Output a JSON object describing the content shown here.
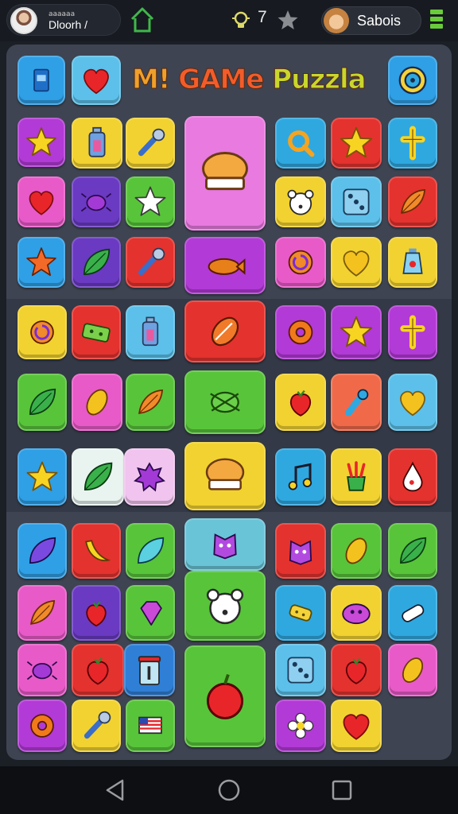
{
  "header": {
    "profile_small": "aaaaaa",
    "profile_name": "Dloorh /",
    "level_value": "7",
    "player_name": "Sabois",
    "accent_green": "#6acb3a"
  },
  "title": {
    "text": "M! GAMe Puzzla",
    "colors": [
      "#f0a02a",
      "#f35c2a",
      "#c9d62c"
    ]
  },
  "icons": {
    "home": "home-icon",
    "level": "bulb-icon",
    "star": "star-icon",
    "menu": "menu-icon"
  },
  "tiles": [
    {
      "name": "phone-tile",
      "icon": "phone",
      "bg": "#2f9fe6"
    },
    {
      "name": "heart-tile",
      "icon": "heart",
      "bg": "#5cc0ea"
    },
    {
      "name": "target-tile",
      "icon": "target",
      "bg": "#2f9fe6"
    },
    {
      "name": "star-tile",
      "icon": "star",
      "bg": "#b23ad6"
    },
    {
      "name": "bottle-tile",
      "icon": "bottle",
      "bg": "#f2d230"
    },
    {
      "name": "tool-tile",
      "icon": "tool",
      "bg": "#f2d230"
    },
    {
      "name": "chef-hat-tile",
      "icon": "hat",
      "bg": "#e87ae0"
    },
    {
      "name": "search-tile",
      "icon": "search",
      "bg": "#2fa8e0"
    },
    {
      "name": "star-tile",
      "icon": "star",
      "bg": "#e4322e"
    },
    {
      "name": "cross-tile",
      "icon": "cross",
      "bg": "#2fa8e0"
    },
    {
      "name": "heart-tile",
      "icon": "heart",
      "bg": "#e85ac8"
    },
    {
      "name": "bug-tile",
      "icon": "bug",
      "bg": "#6a3ac2"
    },
    {
      "name": "star-tile",
      "icon": "star-white",
      "bg": "#58c43a"
    },
    {
      "name": "bear-tile",
      "icon": "bear",
      "bg": "#f2d230"
    },
    {
      "name": "dice-tile",
      "icon": "dice",
      "bg": "#5cc0ea"
    },
    {
      "name": "feather-tile",
      "icon": "feather",
      "bg": "#e4322e"
    },
    {
      "name": "star-tile",
      "icon": "star-orange",
      "bg": "#2f9fe6"
    },
    {
      "name": "leaf-tile",
      "icon": "leaf",
      "bg": "#6a3ac2"
    },
    {
      "name": "wrench-tile",
      "icon": "tool",
      "bg": "#e4322e"
    },
    {
      "name": "fish-tile",
      "icon": "fish",
      "bg": "#b23ad6"
    },
    {
      "name": "spiral-tile",
      "icon": "spiral",
      "bg": "#e85ac8"
    },
    {
      "name": "heart-tile",
      "icon": "heart-gold",
      "bg": "#f2d230"
    },
    {
      "name": "potion-tile",
      "icon": "potion",
      "bg": "#f2d230"
    },
    {
      "name": "swirl-tile",
      "icon": "spiral",
      "bg": "#f2d230"
    },
    {
      "name": "knot-tile",
      "icon": "knot",
      "bg": "#e4322e"
    },
    {
      "name": "bottle-tile",
      "icon": "bottle",
      "bg": "#5cc0ea"
    },
    {
      "name": "candy-tile",
      "icon": "candy",
      "bg": "#e4322e"
    },
    {
      "name": "donut-tile",
      "icon": "donut",
      "bg": "#b23ad6"
    },
    {
      "name": "star-tile",
      "icon": "star",
      "bg": "#b23ad6"
    },
    {
      "name": "cross-tile",
      "icon": "cross",
      "bg": "#b23ad6"
    },
    {
      "name": "leaf-tile",
      "icon": "leaf",
      "bg": "#58c43a"
    },
    {
      "name": "leaf-tile",
      "icon": "seed",
      "bg": "#e85ac8"
    },
    {
      "name": "carrot-tile",
      "icon": "feather",
      "bg": "#58c43a"
    },
    {
      "name": "candy-tile",
      "icon": "candy-green",
      "bg": "#58c43a"
    },
    {
      "name": "berry-tile",
      "icon": "berry",
      "bg": "#f2d230"
    },
    {
      "name": "rocket-tile",
      "icon": "rocket",
      "bg": "#f06a4a"
    },
    {
      "name": "heart-tile",
      "icon": "heart-gold",
      "bg": "#5cc0ea"
    },
    {
      "name": "star-tile",
      "icon": "star",
      "bg": "#2f9fe6"
    },
    {
      "name": "leaf-tile",
      "icon": "leaf",
      "bg": "#e9f4f0"
    },
    {
      "name": "splat-tile",
      "icon": "splat",
      "bg": "#f0c4ee"
    },
    {
      "name": "bun-tile",
      "icon": "hat",
      "bg": "#f2d230"
    },
    {
      "name": "music-tile",
      "icon": "music",
      "bg": "#2fa8e0"
    },
    {
      "name": "plant-tile",
      "icon": "plant",
      "bg": "#f2d230"
    },
    {
      "name": "drop-tile",
      "icon": "drop",
      "bg": "#e4322e"
    },
    {
      "name": "leaf-tile",
      "icon": "leaf-purple",
      "bg": "#2f9fe6"
    },
    {
      "name": "banana-tile",
      "icon": "banana",
      "bg": "#e4322e"
    },
    {
      "name": "leaf-tile",
      "icon": "leaf-blue",
      "bg": "#58c43a"
    },
    {
      "name": "monster-tile",
      "icon": "monster",
      "bg": "#6ac4d8"
    },
    {
      "name": "monster-tile",
      "icon": "monster",
      "bg": "#e4322e"
    },
    {
      "name": "leaf-tile",
      "icon": "seed",
      "bg": "#58c43a"
    },
    {
      "name": "leaf-tile",
      "icon": "leaf",
      "bg": "#58c43a"
    },
    {
      "name": "leaf-tile",
      "icon": "feather",
      "bg": "#e85ac8"
    },
    {
      "name": "berry-tile",
      "icon": "berry",
      "bg": "#6a3ac2"
    },
    {
      "name": "gem-tile",
      "icon": "gem",
      "bg": "#58c43a"
    },
    {
      "name": "bear-tile",
      "icon": "bear",
      "bg": "#58c43a"
    },
    {
      "name": "candy-tile",
      "icon": "candy-yellow",
      "bg": "#2fa8e0"
    },
    {
      "name": "blob-tile",
      "icon": "blob",
      "bg": "#f2d230"
    },
    {
      "name": "bone-tile",
      "icon": "bone",
      "bg": "#2fa8e0"
    },
    {
      "name": "bug-tile",
      "icon": "bug",
      "bg": "#e85ac8"
    },
    {
      "name": "radish-tile",
      "icon": "berry",
      "bg": "#e4322e"
    },
    {
      "name": "jar-tile",
      "icon": "jar",
      "bg": "#2f7fd6"
    },
    {
      "name": "apple-tile",
      "icon": "apple",
      "bg": "#58c43a"
    },
    {
      "name": "dice-tile",
      "icon": "dice",
      "bg": "#5cc0ea"
    },
    {
      "name": "radish-tile",
      "icon": "berry",
      "bg": "#e4322e"
    },
    {
      "name": "seed-tile",
      "icon": "seed",
      "bg": "#e85ac8"
    },
    {
      "name": "donut-tile",
      "icon": "donut",
      "bg": "#b23ad6"
    },
    {
      "name": "tool-tile",
      "icon": "tool",
      "bg": "#f2d230"
    },
    {
      "name": "flag-tile",
      "icon": "flag",
      "bg": "#58c43a"
    },
    {
      "name": "flower-tile",
      "icon": "flower",
      "bg": "#b23ad6"
    },
    {
      "name": "heart-tile",
      "icon": "heart",
      "bg": "#f2d230"
    }
  ],
  "nav": {
    "back": "back-icon",
    "home": "home-circle-icon",
    "recents": "recents-icon"
  }
}
